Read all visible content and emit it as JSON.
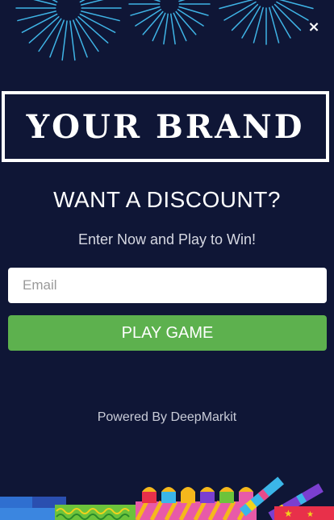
{
  "popup": {
    "brand": "YOUR BRAND",
    "headline": "WANT A DISCOUNT?",
    "subline": "Enter Now and Play to Win!",
    "email_placeholder": "Email",
    "email_value": "",
    "play_label": "PLAY GAME",
    "powered_by": "Powered By DeepMarkit",
    "close_glyph": "×"
  },
  "icons": {
    "close": "close-icon",
    "fireworks": "fireworks-icon",
    "firecrackers": "firecrackers-icon"
  },
  "colors": {
    "background": "#0f1636",
    "button": "#5db14e",
    "firework": "#3fb4e6",
    "text": "#ffffff"
  }
}
